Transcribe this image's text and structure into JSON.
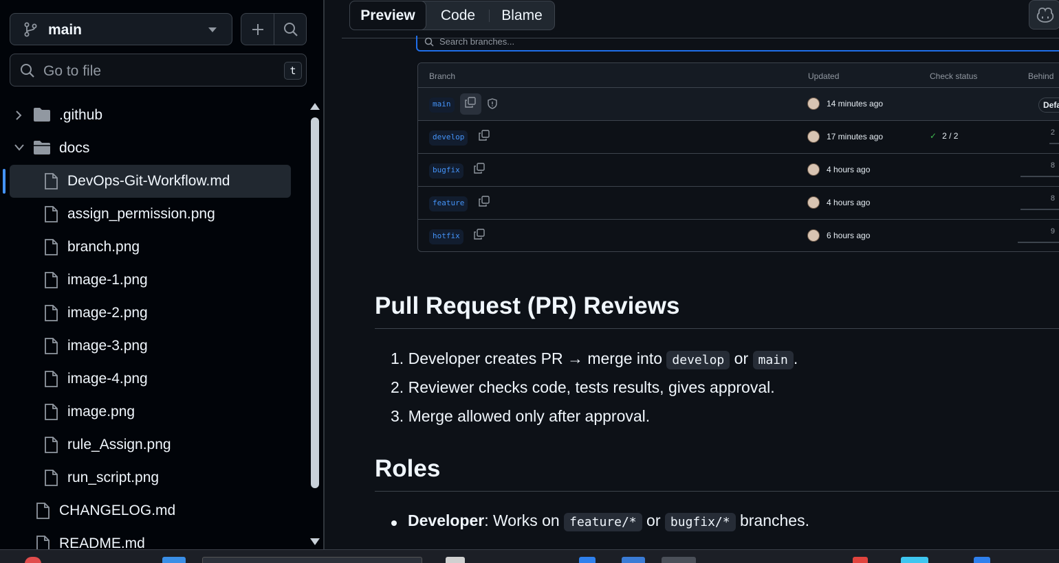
{
  "sidebar": {
    "branch": "main",
    "goto_placeholder": "Go to file",
    "goto_shortcut": "t",
    "tree": [
      {
        "name": ".github",
        "type": "folder",
        "expanded": false
      },
      {
        "name": "docs",
        "type": "folder",
        "expanded": true
      },
      {
        "name": "DevOps-Git-Workflow.md",
        "type": "file",
        "selected": true
      },
      {
        "name": "assign_permission.png",
        "type": "file"
      },
      {
        "name": "branch.png",
        "type": "file"
      },
      {
        "name": "image-1.png",
        "type": "file"
      },
      {
        "name": "image-2.png",
        "type": "file"
      },
      {
        "name": "image-3.png",
        "type": "file"
      },
      {
        "name": "image-4.png",
        "type": "file"
      },
      {
        "name": "image.png",
        "type": "file"
      },
      {
        "name": "rule_Assign.png",
        "type": "file"
      },
      {
        "name": "run_script.png",
        "type": "file"
      },
      {
        "name": "CHANGELOG.md",
        "type": "file"
      },
      {
        "name": "README.md",
        "type": "file"
      }
    ]
  },
  "tabs": {
    "preview": "Preview",
    "code": "Code",
    "blame": "Blame"
  },
  "branches_image": {
    "search_placeholder": "Search branches...",
    "headers": {
      "branch": "Branch",
      "updated": "Updated",
      "check": "Check status",
      "behind": "Behind"
    },
    "rows": [
      {
        "name": "main",
        "updated": "14 minutes ago",
        "check": "",
        "behind": "",
        "default_label": "Defa"
      },
      {
        "name": "develop",
        "updated": "17 minutes ago",
        "check": "2 / 2",
        "behind": "2"
      },
      {
        "name": "bugfix",
        "updated": "4 hours ago",
        "check": "",
        "behind": "8"
      },
      {
        "name": "feature",
        "updated": "4 hours ago",
        "check": "",
        "behind": "8"
      },
      {
        "name": "hotfix",
        "updated": "6 hours ago",
        "check": "",
        "behind": "9"
      }
    ]
  },
  "content": {
    "pr_heading": "Pull Request (PR) Reviews",
    "pr_steps": [
      {
        "num": "1.",
        "text": "Developer creates PR → merge into",
        "code1": "develop",
        "mid": "or",
        "code2": "main",
        "end": "."
      },
      {
        "num": "2.",
        "text": "Reviewer checks code, tests results, gives approval."
      },
      {
        "num": "3.",
        "text": "Merge allowed only after approval."
      }
    ],
    "roles_heading": "Roles",
    "roles": [
      {
        "role": "Developer",
        "text": ": Works on",
        "code1": "feature/*",
        "mid": "or",
        "code2": "bugfix/*",
        "end": "branches."
      }
    ]
  },
  "colors": {
    "accent": "#4493f8",
    "background": "#0d1117",
    "sidebar_bg": "#010409",
    "success": "#3fb950"
  }
}
